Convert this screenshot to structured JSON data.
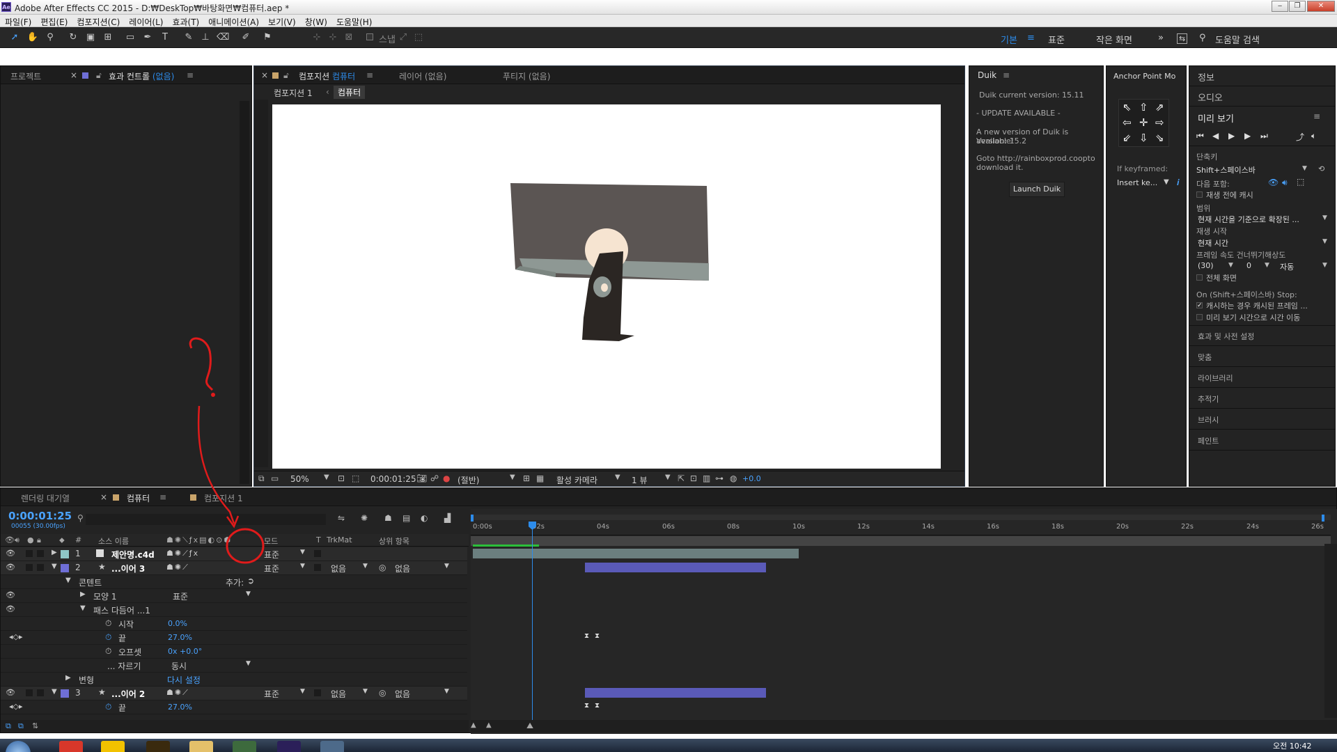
{
  "window": {
    "title": "Adobe After Effects CC 2015 - D:₩DeskTop₩바탕화면₩컴퓨터.aep *",
    "controls": [
      "‒",
      "❐",
      "✕"
    ]
  },
  "menu": [
    "파일(F)",
    "편집(E)",
    "컴포지션(C)",
    "레이어(L)",
    "효과(T)",
    "애니메이션(A)",
    "보기(V)",
    "창(W)",
    "도움말(H)"
  ],
  "toolbar": {
    "snap_label": "스냅",
    "workspaces": [
      "기본",
      "표준",
      "작은 화면"
    ],
    "search_label": "도움말 검색",
    "more": "»"
  },
  "left_panel": {
    "tab_project": "프로젝트",
    "tab_effects": "효과 컨트롤",
    "tab_effects_suffix": "(없음)"
  },
  "comp_panel": {
    "tab_comp": "컴포지션",
    "tab_comp_name": "컴퓨터",
    "tab_layer": "레이어 (없음)",
    "tab_footage": "푸티지 (없음)",
    "crumb1": "컴포지션 1",
    "crumb2": "컴퓨터",
    "zoom": "50%",
    "timecode": "0:00:01:25",
    "resolution": "(절반)",
    "camera": "활성 카메라",
    "views": "1 뷰",
    "exposure": "+0.0"
  },
  "duik_panel": {
    "title": "Duik",
    "version": "Duik current version: 15.11",
    "update": "- UPDATE AVAILABLE -",
    "msg1": "A new version of Duik is available!",
    "msg2": "Version: 15.2",
    "msg3": "Goto http://rainboxprod.coopto",
    "msg4": "download it.",
    "button": "Launch Duik"
  },
  "anchor_panel": {
    "title": "Anchor Point Mo",
    "if_keyframed": "If keyframed:",
    "dropdown": "Insert ke..."
  },
  "right_panel": {
    "info": "정보",
    "audio": "오디오",
    "preview": "미리 보기",
    "shortcut_label": "단축키",
    "shortcut_value": "Shift+스페이스바",
    "include_label": "다음 포함:",
    "cache_before": "재생 전에 캐시",
    "range_label": "범위",
    "range_value": "현재 시간을 기준으로 확장된 ...",
    "play_from_label": "재생 시작",
    "play_from_value": "현재 시간",
    "frame_label": "프레임 속도  건너뛰기해상도",
    "fps": "(30)",
    "skip": "0",
    "res": "자동",
    "fullscreen": "전체 화면",
    "on_stop": "On (Shift+스페이스바) Stop:",
    "cache_opt": "캐시하는 경우 캐시된 프레임 ...",
    "move_time": "미리 보기 시간으로 시간 이동",
    "effects": "효과 및 사전 설정",
    "align": "맞춤",
    "library": "라이브러리",
    "tracker": "추적기",
    "brush": "브러시",
    "paint": "페인트"
  },
  "timeline": {
    "tab_render": "렌더링 대기열",
    "tab_comp": "컴퓨터",
    "tab_comp2": "컴포지션 1",
    "timecode": "0:00:01:25",
    "frames": "00055 (30.00fps)",
    "headers": {
      "num": "#",
      "source": "소스 이름",
      "mode": "모드",
      "t": "T",
      "trkmat": "TrkMat",
      "parent": "상위 항목"
    },
    "ruler": [
      "0:00s",
      "02s",
      "04s",
      "06s",
      "08s",
      "10s",
      "12s",
      "14s",
      "16s",
      "18s",
      "20s",
      "22s",
      "24s",
      "26s"
    ],
    "layers": [
      {
        "num": "1",
        "name": "제안명.c4d",
        "mode": "표준",
        "trkmat": "",
        "parent": ""
      },
      {
        "num": "2",
        "name": "...이어 3",
        "mode": "표준",
        "trkmat": "없음",
        "parent": "없음"
      },
      {
        "num": "3",
        "name": "...이어 2",
        "mode": "표준",
        "trkmat": "없음",
        "parent": "없음"
      }
    ],
    "props": {
      "contents": "콘텐트",
      "add": "추가:",
      "shape": "모양 1",
      "shape_mode": "표준",
      "trim": "패스 다듬어 ...1",
      "start": "시작",
      "start_val": "0.0%",
      "end": "끝",
      "end_val": "27.0%",
      "offset": "오프셋",
      "offset_val": "0x +0.0°",
      "trim_mult": "... 자르기",
      "trim_mult_val": "동시",
      "transform": "변형",
      "reset": "다시 설정",
      "end2": "끝",
      "end2_val": "27.0%"
    }
  },
  "annotation": {
    "mark": "?"
  },
  "taskbar": {
    "clock": "오전 10:42"
  },
  "colors": {
    "accent_blue": "#2d8ceb",
    "layer_cyan": "#8fc7c7",
    "layer_purple": "#6f6fd6",
    "bar_teal": "#6b7f7f",
    "bar_purple": "#5a5ab8",
    "annotation_red": "#e01b1b"
  }
}
